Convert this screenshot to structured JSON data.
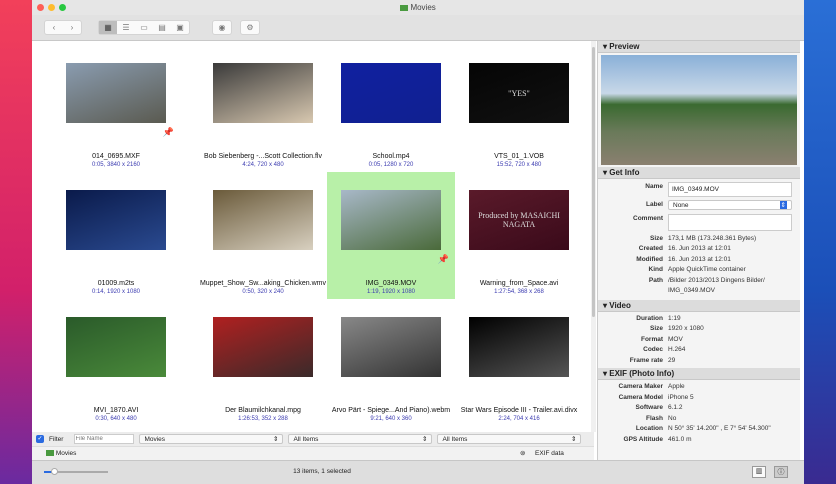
{
  "window": {
    "title": "Movies"
  },
  "toolbar": {
    "back": "‹",
    "forward": "›",
    "views": [
      "grid-view",
      "list-view",
      "cover-view",
      "split-view",
      "filmstrip-view"
    ],
    "quicklook": "eye",
    "settings": "gear"
  },
  "items": [
    {
      "name": "014_0695.MXF",
      "info": "0:05, 3840 x 2160",
      "colors": [
        "#8a9cb0",
        "#5a5a50"
      ],
      "pin": true
    },
    {
      "name": "Bob Siebenberg -...Scott Collection.flv",
      "info": "4:24, 720 x 480",
      "colors": [
        "#3a3a3a",
        "#d8c8b0"
      ]
    },
    {
      "name": "School.mp4",
      "info": "0:05, 1280 x 720",
      "colors": [
        "#1020a0",
        "#102090"
      ]
    },
    {
      "name": "VTS_01_1.VOB",
      "info": "15:52, 720 x 480",
      "colors": [
        "#050505",
        "#111"
      ],
      "text": "\"YES\""
    },
    {
      "name": "01009.m2ts",
      "info": "0:14, 1920 x 1080",
      "colors": [
        "#0a1a4a",
        "#2a4a90"
      ]
    },
    {
      "name": "Muppet_Show_Sw...aking_Chicken.wmv",
      "info": "0:50, 320 x 240",
      "colors": [
        "#6a5a3a",
        "#d8d0c0"
      ]
    },
    {
      "name": "IMG_0349.MOV",
      "info": "1:19, 1920 x 1080",
      "colors": [
        "#a8b8c8",
        "#4a6a3a"
      ],
      "pin": true,
      "selected": true
    },
    {
      "name": "Warning_from_Space.avi",
      "info": "1:27:54, 368 x 268",
      "colors": [
        "#5a1a2a",
        "#3a0a1a"
      ],
      "text": "Produced by MASAICHI NAGATA"
    },
    {
      "name": "MVI_1870.AVI",
      "info": "0:30, 640 x 480",
      "colors": [
        "#2a5a2a",
        "#4a8a3a"
      ]
    },
    {
      "name": "Der Blaumilchkanal.mpg",
      "info": "1:26:53, 352 x 288",
      "colors": [
        "#b02020",
        "#3a2a2a"
      ]
    },
    {
      "name": "Arvo Pärt - Spiege...And Piano).webm",
      "info": "9:21, 640 x 360",
      "colors": [
        "#888",
        "#333"
      ]
    },
    {
      "name": "Star Wars Episode III - Trailer.avi.divx",
      "info": "2:24, 704 x 416",
      "colors": [
        "#000",
        "#555"
      ]
    }
  ],
  "sidebar": {
    "preview_title": "Preview",
    "getinfo_title": "Get Info",
    "getinfo": {
      "name_label": "Name",
      "name": "IMG_0349.MOV",
      "label_label": "Label",
      "label": "None",
      "comment_label": "Comment",
      "comment": "",
      "rows": [
        {
          "k": "Size",
          "v": "173,1 MB (173.248.361 Bytes)"
        },
        {
          "k": "Created",
          "v": "16. Jun 2013 at 12:01"
        },
        {
          "k": "Modified",
          "v": "16. Jun 2013 at 12:01"
        },
        {
          "k": "Kind",
          "v": "Apple QuickTime container"
        },
        {
          "k": "Path",
          "v": "/Bilder 2013/2013 Dingens Bilder/ IMG_0349.MOV"
        }
      ]
    },
    "video_title": "Video",
    "video": [
      {
        "k": "Duration",
        "v": "1:19"
      },
      {
        "k": "Size",
        "v": "1920 x 1080"
      },
      {
        "k": "Format",
        "v": "MOV"
      },
      {
        "k": "Codec",
        "v": "H.264"
      },
      {
        "k": "Frame rate",
        "v": "29"
      }
    ],
    "exif_title": "EXIF (Photo Info)",
    "exif": [
      {
        "k": "Camera Maker",
        "v": "Apple"
      },
      {
        "k": "Camera Model",
        "v": "iPhone 5"
      },
      {
        "k": "Software",
        "v": "6.1.2"
      },
      {
        "k": "Flash",
        "v": "No"
      },
      {
        "k": "Location",
        "v": "N 50° 35' 14.200\" , E 7° 54' 54.300\""
      },
      {
        "k": "GPS Altitude",
        "v": "461.0 m"
      }
    ]
  },
  "filter": {
    "label": "Filter",
    "checked": true,
    "placeholder": "File Name",
    "popup1": "Movies",
    "popup2": "All Items",
    "popup3": "All Items"
  },
  "pathbar": {
    "folder": "Movies",
    "exif": "EXIF data"
  },
  "status": {
    "text": "13 items, 1 selected",
    "zoom": 0.15
  }
}
